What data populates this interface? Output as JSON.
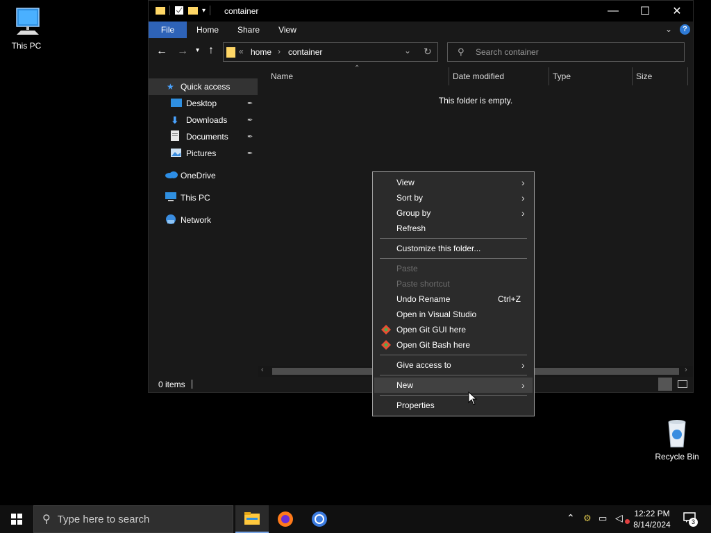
{
  "desktop": {
    "this_pc_label": "This PC",
    "recycle_bin_label": "Recycle Bin"
  },
  "window": {
    "title": "container",
    "ribbon_tabs": [
      "File",
      "Home",
      "Share",
      "View"
    ],
    "address": {
      "overflow": "«",
      "crumbs": [
        "home",
        "container"
      ]
    },
    "search_placeholder": "Search container",
    "nav_pane": {
      "quick_access": "Quick access",
      "pinned": [
        "Desktop",
        "Downloads",
        "Documents",
        "Pictures"
      ],
      "onedrive": "OneDrive",
      "this_pc": "This PC",
      "network": "Network"
    },
    "columns": [
      "Name",
      "Date modified",
      "Type",
      "Size"
    ],
    "empty_message": "This folder is empty.",
    "status_items": "0 items"
  },
  "context_menu": {
    "view": "View",
    "sort_by": "Sort by",
    "group_by": "Group by",
    "refresh": "Refresh",
    "customize": "Customize this folder...",
    "paste": "Paste",
    "paste_shortcut": "Paste shortcut",
    "undo_rename": "Undo Rename",
    "undo_shortcut": "Ctrl+Z",
    "open_vs": "Open in Visual Studio",
    "git_gui": "Open Git GUI here",
    "git_bash": "Open Git Bash here",
    "give_access": "Give access to",
    "new": "New",
    "properties": "Properties"
  },
  "taskbar": {
    "search_placeholder": "Type here to search",
    "time": "12:22 PM",
    "date": "8/14/2024",
    "notification_count": "3"
  },
  "colors": {
    "accent": "#2e63b8",
    "menu_bg": "#2b2b2b",
    "window_bg": "#191919"
  }
}
